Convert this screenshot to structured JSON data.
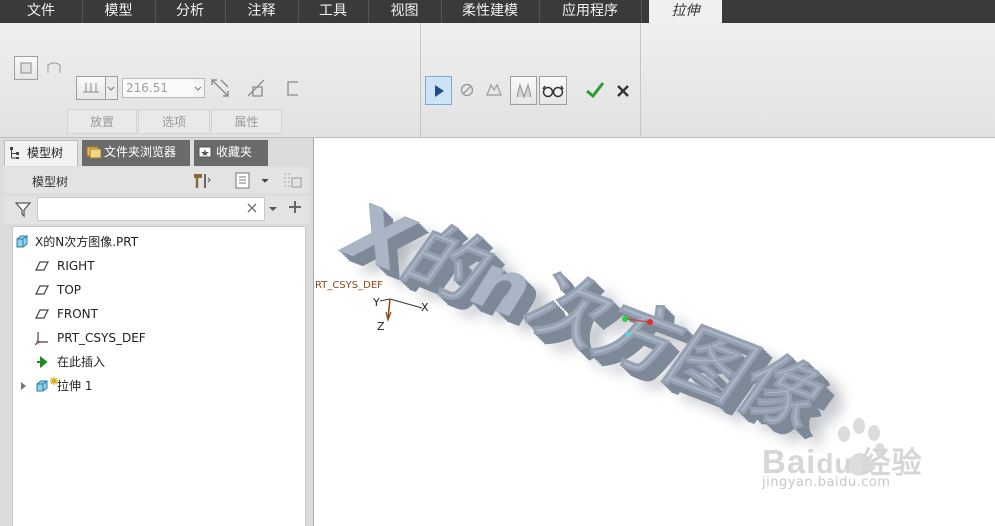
{
  "menu": {
    "items": [
      "文件",
      "模型",
      "分析",
      "注释",
      "工具",
      "视图",
      "柔性建模",
      "应用程序"
    ],
    "active_tab": "拉伸"
  },
  "ribbon": {
    "depth_value": "216.51",
    "tabs": {
      "placement": "放置",
      "options": "选项",
      "properties": "属性"
    }
  },
  "panel": {
    "tabs": {
      "model_tree": "模型树",
      "folder_browser": "文件夹浏览器",
      "favorites": "收藏夹"
    },
    "tree_title": "模型树",
    "filter_value": "",
    "items": {
      "part": "X的N次方图像.PRT",
      "right": "RIGHT",
      "top": "TOP",
      "front": "FRONT",
      "csys": "PRT_CSYS_DEF",
      "insert_here": "在此插入",
      "extrude": "拉伸 1"
    }
  },
  "graphics": {
    "model_text": "X的n次方图像",
    "csys_label": "RT_CSYS_DEF",
    "axis_labels": {
      "x": "X",
      "y": "Y",
      "z": "Z"
    },
    "watermark": {
      "logo_left": "Bai",
      "logo_mid": "du",
      "logo_right": "经验",
      "url": "jingyan.baidu.com"
    }
  },
  "colors": {
    "menubar": "#3a3a3a",
    "ribbon": "#e8e8e8",
    "accept": "#2e9b2e",
    "model_face": "#aab6c6",
    "model_side": "#7e8998"
  }
}
